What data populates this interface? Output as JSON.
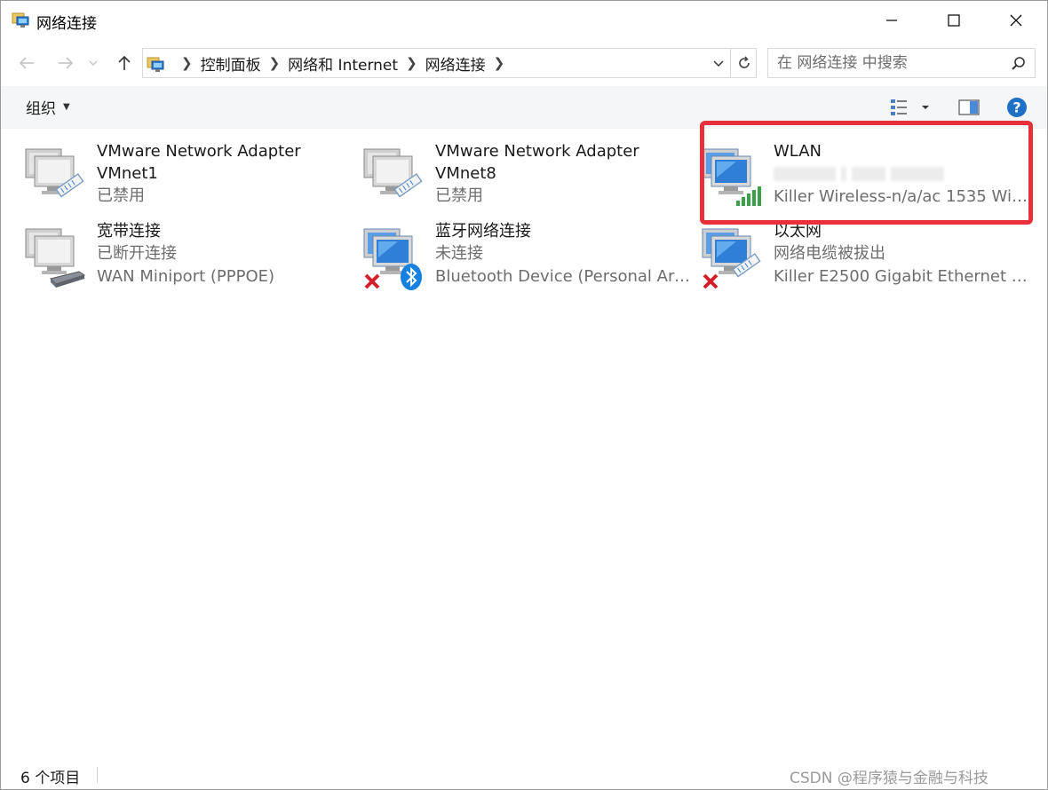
{
  "window": {
    "title": "网络连接"
  },
  "address": {
    "crumbs": [
      "控制面板",
      "网络和 Internet",
      "网络连接"
    ]
  },
  "search": {
    "placeholder": "在 网络连接 中搜索"
  },
  "toolbar": {
    "organize_label": "组织",
    "help_label": "?"
  },
  "items": [
    {
      "name": "VMware Network Adapter",
      "name2": "VMnet1",
      "status": "已禁用",
      "icon": "ethernet-adapter-icon"
    },
    {
      "name": "VMware Network Adapter",
      "name2": "VMnet8",
      "status": "已禁用",
      "icon": "ethernet-adapter-icon"
    },
    {
      "name": "WLAN",
      "status_blurred": true,
      "device": "Killer Wireless-n/a/ac 1535 Wir...",
      "icon": "wireless-adapter-icon",
      "highlighted": true
    },
    {
      "name": "宽带连接",
      "status": "已断开连接",
      "device": "WAN Miniport (PPPOE)",
      "icon": "broadband-modem-icon"
    },
    {
      "name": "蓝牙网络连接",
      "status": "未连接",
      "device": "Bluetooth Device (Personal Are...",
      "icon": "bluetooth-adapter-icon"
    },
    {
      "name": "以太网",
      "status": "网络电缆被拔出",
      "device": "Killer E2500 Gigabit Ethernet C...",
      "icon": "ethernet-adapter-icon"
    }
  ],
  "statusbar": {
    "count": "6 个项目",
    "watermark": "CSDN @程序猿与金融与科技"
  },
  "colors": {
    "highlight": "#e8303a",
    "help": "#1e6fc7",
    "signal": "#3aa14a",
    "error": "#d4202a",
    "bluetooth": "#1581e0"
  }
}
